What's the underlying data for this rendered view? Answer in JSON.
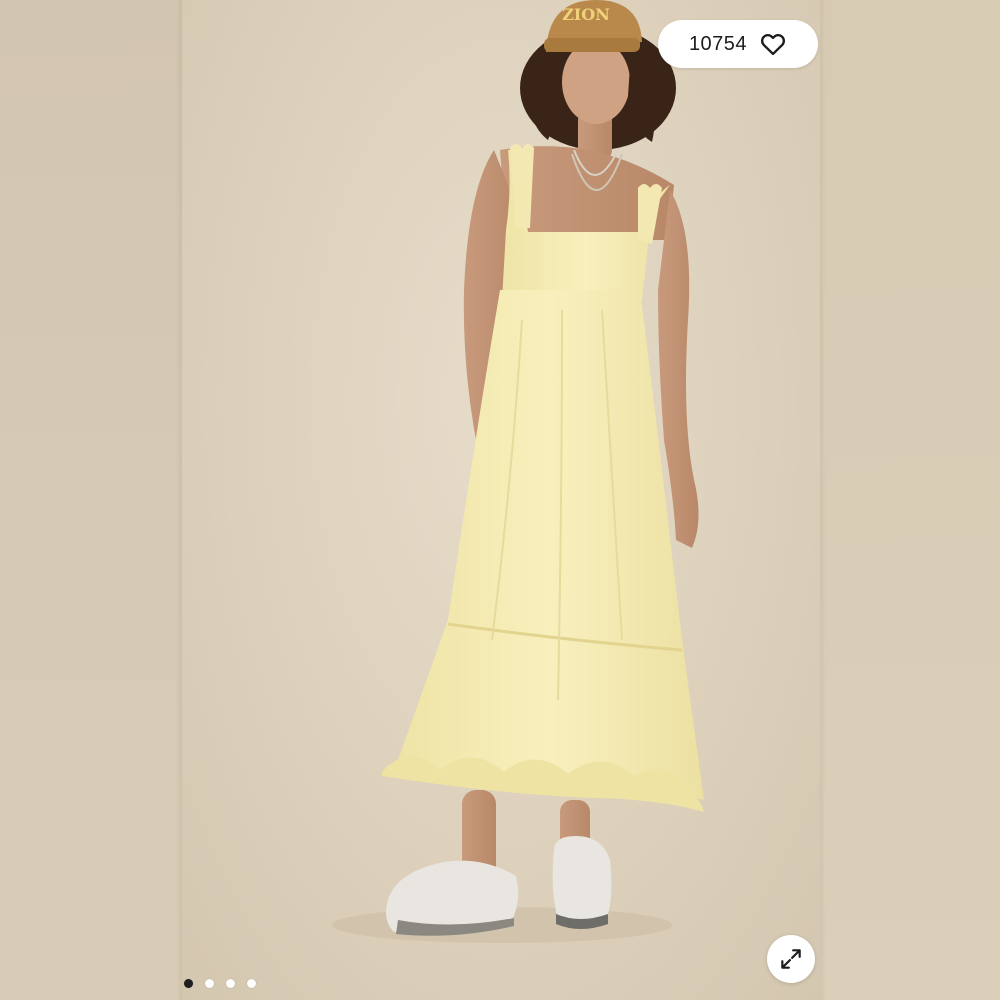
{
  "like_count": "10754",
  "icons": {
    "like": "heart-outline-icon",
    "expand": "expand-arrows-icon"
  },
  "carousel": {
    "total_images": 4,
    "active_index": 0
  },
  "photo": {
    "cap_text": "ZION"
  },
  "colors": {
    "background": "#ddd1bc",
    "dress": "#f5eab0",
    "pill_bg": "#ffffff",
    "dot_active": "#1e1e1e",
    "dot_inactive": "#ffffff"
  }
}
